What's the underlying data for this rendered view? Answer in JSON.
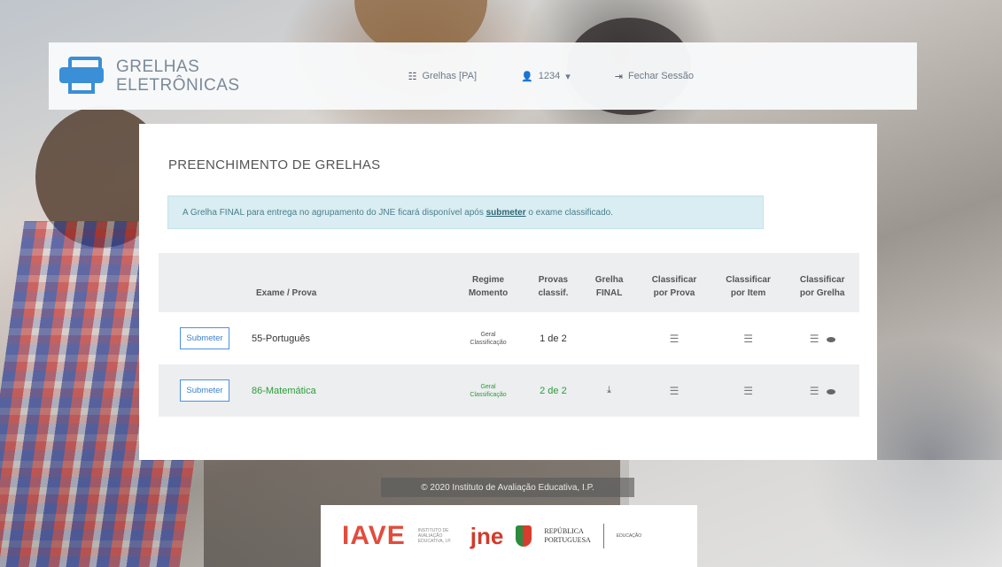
{
  "brand": {
    "line1": "GRELHAS",
    "line2": "ELETRÔNICAS"
  },
  "nav": {
    "grelhas": "Grelhas [PA]",
    "user": "1234",
    "logout": "Fechar Sessão"
  },
  "page_title": "PREENCHIMENTO DE GRELHAS",
  "alert": {
    "before": "A Grelha FINAL para entrega no agrupamento do JNE ficará disponível após ",
    "link": "submeter",
    "after": " o exame classificado."
  },
  "table": {
    "headers": {
      "exame": "Exame / Prova",
      "regime1": "Regime",
      "regime2": "Momento",
      "provas1": "Provas",
      "provas2": "classif.",
      "grelha1": "Grelha",
      "grelha2": "FINAL",
      "cprova1": "Classificar",
      "cprova2": "por Prova",
      "citem1": "Classificar",
      "citem2": "por Item",
      "cgrelha1": "Classificar",
      "cgrelha2": "por Grelha"
    },
    "rows": [
      {
        "button": "Submeter",
        "exame": "55-Português",
        "regime1": "Geral",
        "regime2": "Classificação",
        "provas": "1 de 2"
      },
      {
        "button": "Submeter",
        "exame": "86-Matemática",
        "regime1": "Geral",
        "regime2": "Classificação",
        "provas": "2 de 2"
      }
    ]
  },
  "footer": {
    "copyright": "© 2020 Instituto de Avaliação Educativa, I.P.",
    "iave": "IAVE",
    "iave_sub": "INSTITUTO DE AVALIAÇÃO EDUCATIVA, I.P.",
    "jne": "jne",
    "rep1": "REPÚBLICA",
    "rep2": "PORTUGUESA",
    "edu": "EDUCAÇÃO"
  },
  "colors": {
    "primary": "#3a8fd6",
    "success": "#2c9c3a",
    "alert_bg": "#d9edf2"
  },
  "icons": [
    "printer-icon",
    "grid-icon",
    "user-icon",
    "logout-icon",
    "list-icon",
    "eye-icon",
    "download-icon"
  ]
}
